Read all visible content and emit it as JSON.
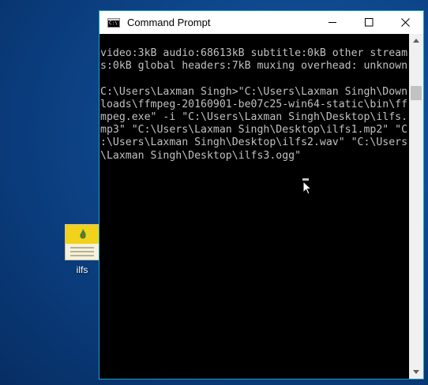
{
  "window": {
    "title": "Command Prompt",
    "icon": "cmd-icon",
    "controls": {
      "minimize": "minimize-icon",
      "maximize": "maximize-icon",
      "close": "close-icon"
    }
  },
  "console": {
    "lines": [
      "video:3kB audio:68613kB subtitle:0kB other stream",
      "s:0kB global headers:7kB muxing overhead: unknown",
      "",
      "C:\\Users\\Laxman Singh>\"C:\\Users\\Laxman Singh\\Down",
      "loads\\ffmpeg-20160901-be07c25-win64-static\\bin\\ff",
      "mpeg.exe\" -i \"C:\\Users\\Laxman Singh\\Desktop\\ilfs.",
      "mp3\" \"C:\\Users\\Laxman Singh\\Desktop\\ilfs1.mp2\" \"C",
      ":\\Users\\Laxman Singh\\Desktop\\ilfs2.wav\" \"C:\\Users",
      "\\Laxman Singh\\Desktop\\ilfs3.ogg\""
    ],
    "text_color": "#c0c0c0",
    "background": "#000000"
  },
  "desktop": {
    "icon_label": "ilfs",
    "background": "#0f4a90"
  },
  "accent": "#1f9fc6"
}
